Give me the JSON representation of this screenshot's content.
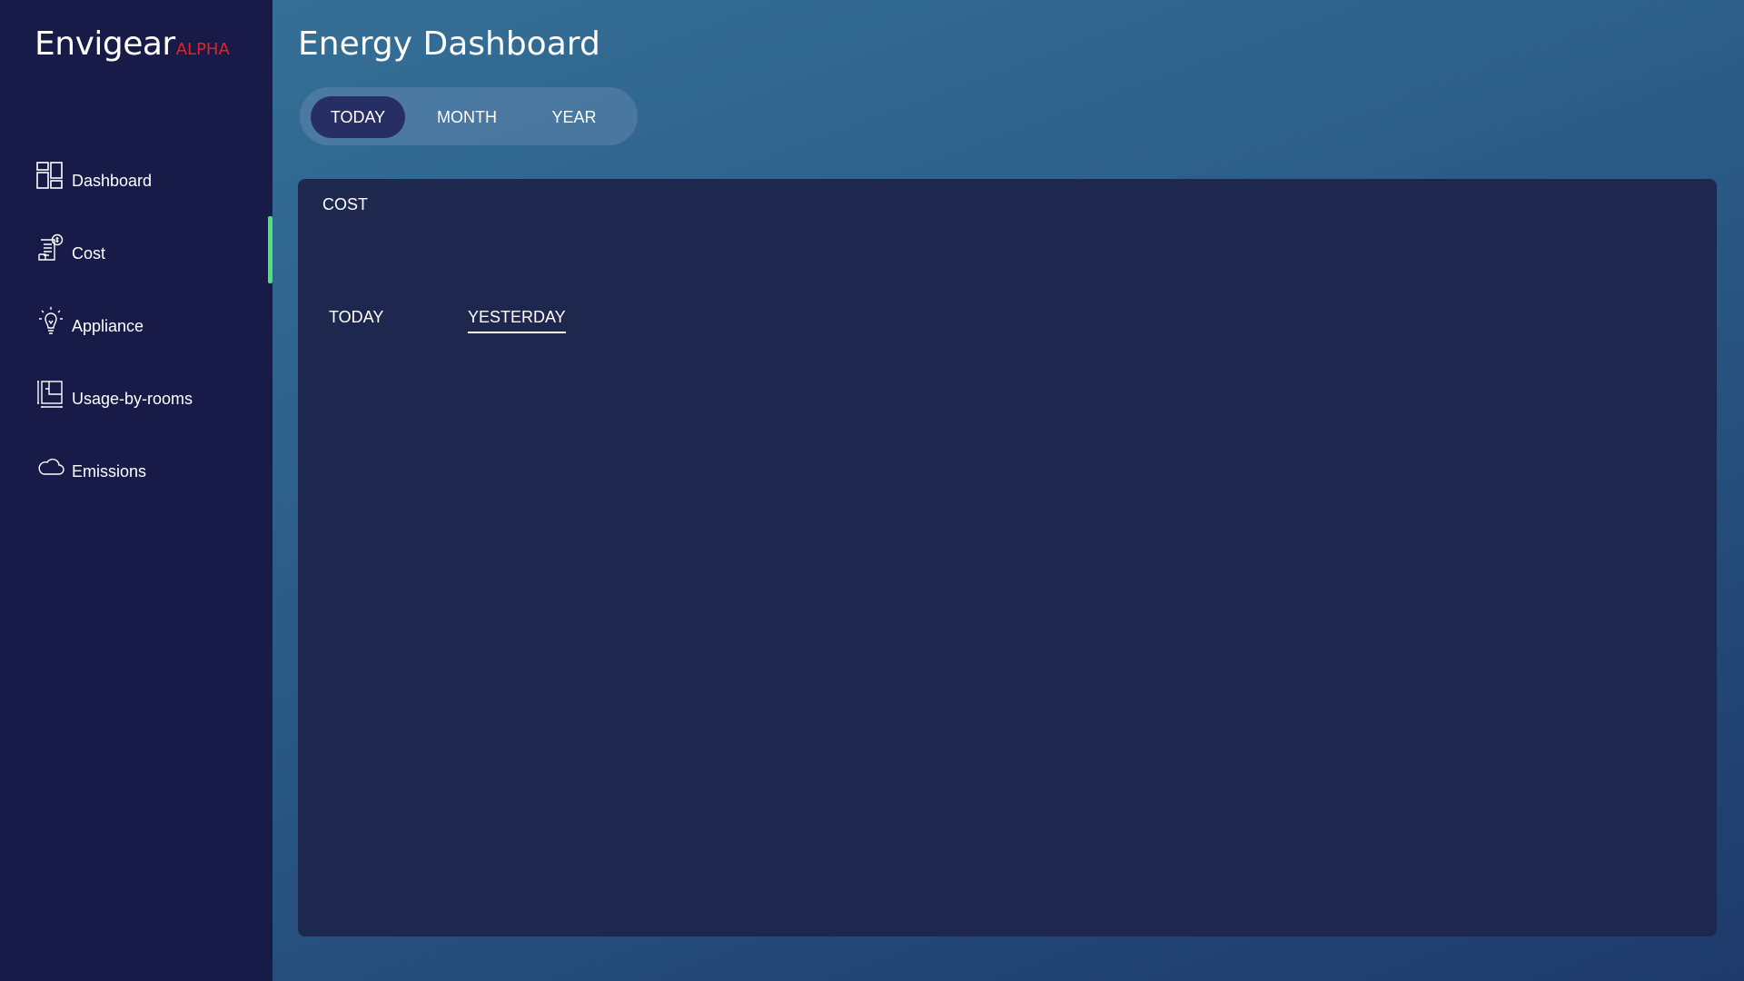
{
  "brand": {
    "name": "Envigear",
    "tag": "ALPHA"
  },
  "sidebar": {
    "items": [
      {
        "label": "Dashboard",
        "icon": "dashboard-grid-icon"
      },
      {
        "label": "Cost",
        "icon": "cost-receipt-icon"
      },
      {
        "label": "Appliance",
        "icon": "lightbulb-icon"
      },
      {
        "label": "Usage-by-rooms",
        "icon": "floor-plan-icon"
      },
      {
        "label": "Emissions",
        "icon": "cloud-icon"
      }
    ],
    "active": "Cost",
    "active_color": "#4ee374"
  },
  "header": {
    "title": "Energy Dashboard"
  },
  "range_tabs": {
    "items": [
      "TODAY",
      "MONTH",
      "YEAR"
    ],
    "selected": "TODAY"
  },
  "card": {
    "title": "COST",
    "sub_tabs": [
      "TODAY",
      "YESTERDAY"
    ],
    "selected": "YESTERDAY"
  },
  "colors": {
    "sidebar_bg": "#181a47",
    "card_bg": "#1e284f",
    "brand_tag": "#e8202a",
    "accent": "#4ee374"
  }
}
